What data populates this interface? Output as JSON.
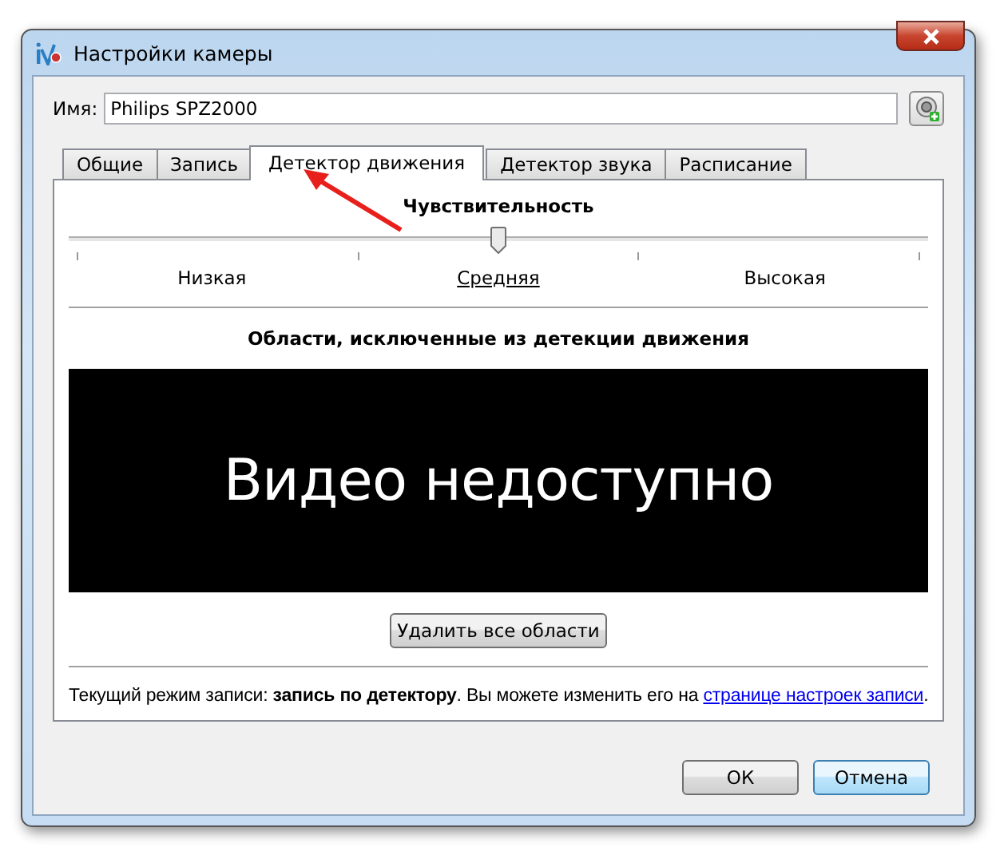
{
  "window": {
    "title": "Настройки камеры"
  },
  "name_field": {
    "label": "Имя:",
    "value": "Philips SPZ2000"
  },
  "tabs": [
    {
      "label": "Общие",
      "selected": false
    },
    {
      "label": "Запись",
      "selected": false
    },
    {
      "label": "Детектор движения",
      "selected": true
    },
    {
      "label": "Детектор звука",
      "selected": false
    },
    {
      "label": "Расписание",
      "selected": false
    }
  ],
  "sensitivity": {
    "title": "Чувствительность",
    "level": 0.5,
    "labels": [
      {
        "label": "Низкая",
        "selected": false
      },
      {
        "label": "Средняя",
        "selected": true
      },
      {
        "label": "Высокая",
        "selected": false
      }
    ]
  },
  "exclusions": {
    "title": "Области, исключенные из детекции движения",
    "video_message": "Видео недоступно",
    "button": "Удалить все области"
  },
  "info": {
    "text": "Текущий режим записи: **запись по детектору**. Вы можете изменить его на ",
    "link": "странице настроек записи",
    "end": "."
  },
  "buttons": [
    {
      "label": "ОК",
      "default": false
    },
    {
      "label": "Отмена",
      "default": true
    }
  ]
}
